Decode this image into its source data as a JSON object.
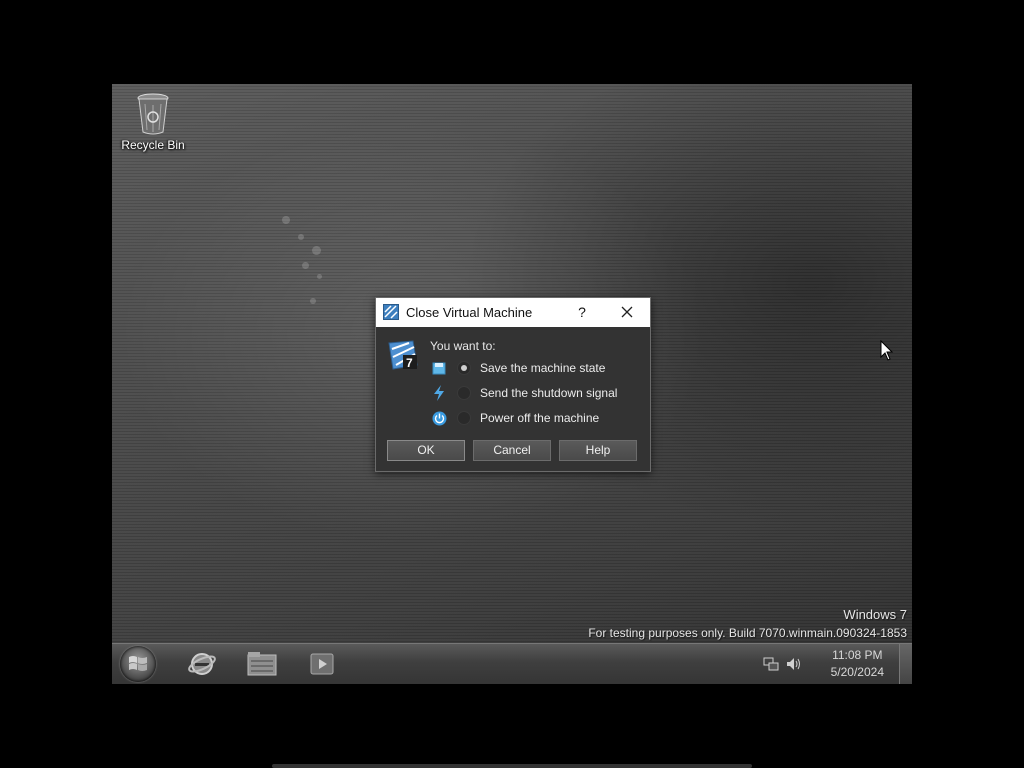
{
  "desktop": {
    "recycle_bin_label": "Recycle Bin",
    "watermark_title": "Windows 7",
    "watermark_build": "For testing purposes only. Build 7070.winmain.090324-1853"
  },
  "taskbar": {
    "pinned": [
      "start-orb",
      "internet-explorer-icon",
      "windows-explorer-icon",
      "media-player-icon"
    ],
    "tray_icons": [
      "network-icon",
      "volume-icon"
    ],
    "clock_time": "11:08 PM",
    "clock_date": "5/20/2024"
  },
  "dialog": {
    "title": "Close Virtual Machine",
    "help_glyph": "?",
    "prompt": "You want to:",
    "options": [
      {
        "label": "Save the machine state",
        "icon": "save-state-icon",
        "selected": true
      },
      {
        "label": "Send the shutdown signal",
        "icon": "shutdown-signal-icon",
        "selected": false
      },
      {
        "label": "Power off the machine",
        "icon": "power-off-icon",
        "selected": false
      }
    ],
    "buttons": {
      "ok": "OK",
      "cancel": "Cancel",
      "help": "Help"
    }
  }
}
